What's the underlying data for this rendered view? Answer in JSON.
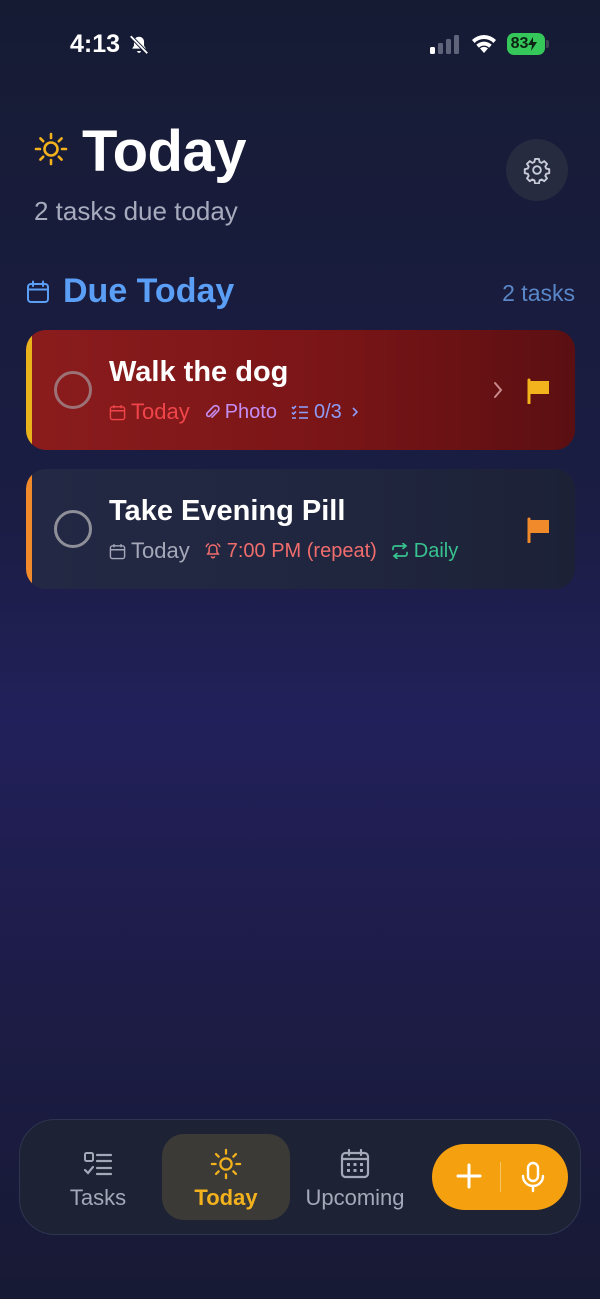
{
  "status_bar": {
    "time": "4:13",
    "battery": "83",
    "icons": [
      "bell-slash-icon",
      "cellular-signal-icon",
      "wifi-icon",
      "battery-charging-icon"
    ]
  },
  "header": {
    "title": "Today",
    "subtitle": "2 tasks due today",
    "icons": [
      "sun-icon",
      "gear-icon"
    ]
  },
  "section": {
    "title": "Due Today",
    "count": "2 tasks"
  },
  "tasks": [
    {
      "title": "Walk the dog",
      "due": "Today",
      "attachment": "Photo",
      "subtasks": "0/3",
      "flag_color": "#f2b31d",
      "accent_color": "#e9b31c"
    },
    {
      "title": "Take Evening Pill",
      "due": "Today",
      "reminder": "7:00 PM (repeat)",
      "recurrence": "Daily",
      "flag_color": "#f08a2a",
      "accent_color": "#f08a2a"
    }
  ],
  "tab_bar": {
    "tabs": [
      {
        "label": "Tasks",
        "icon": "checklist-icon"
      },
      {
        "label": "Today",
        "icon": "sun-icon",
        "active": true
      },
      {
        "label": "Upcoming",
        "icon": "calendar-grid-icon"
      }
    ],
    "fab_icons": [
      "plus-icon",
      "microphone-icon"
    ],
    "accent_color": "#f5a10f"
  }
}
